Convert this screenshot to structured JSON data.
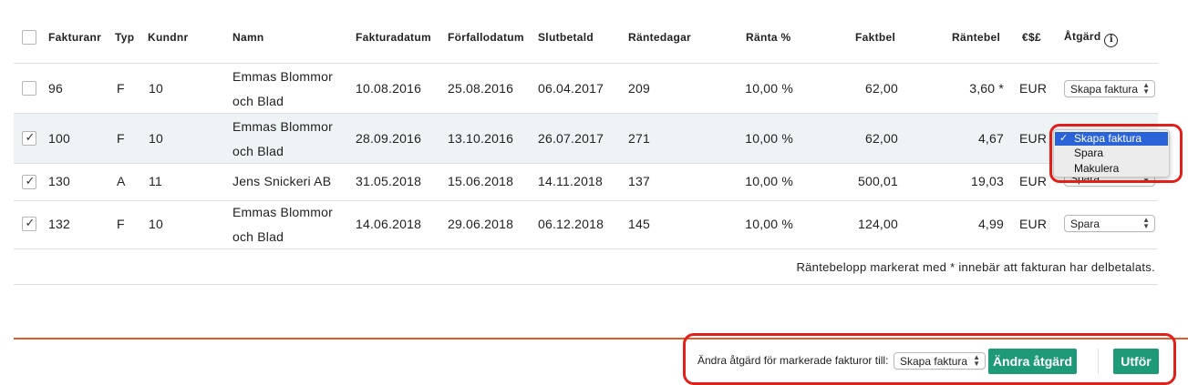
{
  "header": {
    "fakturanr": "Fakturanr",
    "typ": "Typ",
    "kundnr": "Kundnr",
    "namn": "Namn",
    "fakturadatum": "Fakturadatum",
    "forfallodatum": "Förfallodatum",
    "slutbetald": "Slutbetald",
    "rantedagar": "Räntedagar",
    "ranta": "Ränta %",
    "faktbel": "Faktbel",
    "rantebel": "Räntebel",
    "valuta": "€$£",
    "atgard": "Åtgärd",
    "info_icon": "i"
  },
  "rows": [
    {
      "checked": false,
      "check_mark": "",
      "fakturanr": "96",
      "typ": "F",
      "kundnr": "10",
      "namn1": "Emmas Blommor",
      "namn2": "och Blad",
      "fakturadatum": "10.08.2016",
      "forfallodatum": "25.08.2016",
      "slutbetald": "06.04.2017",
      "rantedagar": "209",
      "ranta": "10,00 %",
      "faktbel": "62,00",
      "rantebel": "3,60 *",
      "valuta": "EUR",
      "atgard": "Skapa faktura"
    },
    {
      "checked": true,
      "check_mark": "✓",
      "fakturanr": "100",
      "typ": "F",
      "kundnr": "10",
      "namn1": "Emmas Blommor",
      "namn2": "och Blad",
      "fakturadatum": "28.09.2016",
      "forfallodatum": "13.10.2016",
      "slutbetald": "26.07.2017",
      "rantedagar": "271",
      "ranta": "10,00 %",
      "faktbel": "62,00",
      "rantebel": "4,67",
      "valuta": "EUR",
      "atgard": "Skapa faktura"
    },
    {
      "checked": true,
      "check_mark": "✓",
      "fakturanr": "130",
      "typ": "A",
      "kundnr": "11",
      "namn1": "Jens Snickeri AB",
      "namn2": "",
      "fakturadatum": "31.05.2018",
      "forfallodatum": "15.06.2018",
      "slutbetald": "14.11.2018",
      "rantedagar": "137",
      "ranta": "10,00 %",
      "faktbel": "500,01",
      "rantebel": "19,03",
      "valuta": "EUR",
      "atgard": "Spara"
    },
    {
      "checked": true,
      "check_mark": "✓",
      "fakturanr": "132",
      "typ": "F",
      "kundnr": "10",
      "namn1": "Emmas Blommor",
      "namn2": "och Blad",
      "fakturadatum": "14.06.2018",
      "forfallodatum": "29.06.2018",
      "slutbetald": "06.12.2018",
      "rantedagar": "145",
      "ranta": "10,00 %",
      "faktbel": "124,00",
      "rantebel": "4,99",
      "valuta": "EUR",
      "atgard": "Spara"
    }
  ],
  "dropdown": {
    "options": [
      "Skapa faktura",
      "Spara",
      "Makulera"
    ],
    "selected": "Skapa faktura",
    "check_mark": "✓"
  },
  "note": "Räntebelopp markerat med * innebär att fakturan har delbetalats.",
  "footer": {
    "label": "Ändra åtgärd för markerade fakturor till:",
    "select_value": "Skapa faktura",
    "change_button": "Ändra åtgärd",
    "execute_button": "Utför"
  },
  "colors": {
    "accent_button": "#1e9a78",
    "highlight_border": "#e0201a",
    "footer_border": "#e45a2c",
    "dropdown_active": "#2a63d8",
    "selected_row": "#eef3f5"
  }
}
